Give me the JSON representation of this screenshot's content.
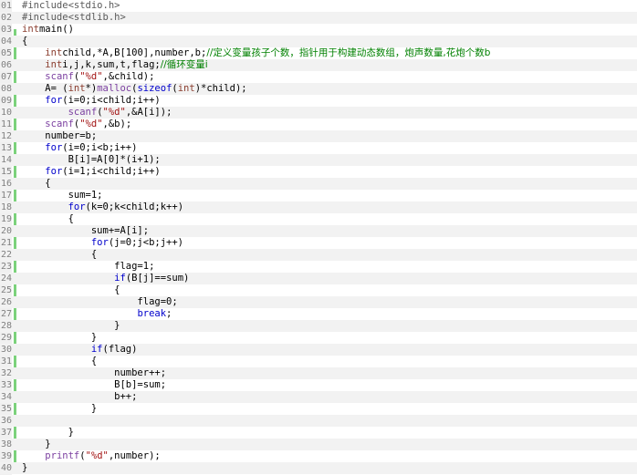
{
  "editor": {
    "lines": [
      {
        "num": "01",
        "seg": [
          [
            "pp",
            "#include<stdio.h>"
          ]
        ]
      },
      {
        "num": "02",
        "seg": [
          [
            "pp",
            "#include<stdlib.h>"
          ]
        ]
      },
      {
        "num": "03",
        "seg": [
          [
            "ty",
            "int"
          ],
          [
            "",
            "main()"
          ]
        ]
      },
      {
        "num": "04",
        "seg": [
          [
            "",
            "{"
          ]
        ]
      },
      {
        "num": "05",
        "seg": [
          [
            "",
            "    "
          ],
          [
            "ty",
            "int"
          ],
          [
            "",
            "child,*A,B[100],number,b;"
          ],
          [
            "cm",
            "//定义变量孩子个数，指针用于构建动态数组，炮声数量,花炮个数b"
          ]
        ]
      },
      {
        "num": "06",
        "seg": [
          [
            "",
            "    "
          ],
          [
            "ty",
            "int"
          ],
          [
            "",
            "i,j,k,sum,t,flag;"
          ],
          [
            "cm",
            "//循环变量i"
          ]
        ]
      },
      {
        "num": "07",
        "seg": [
          [
            "",
            "    "
          ],
          [
            "fn",
            "scanf"
          ],
          [
            "",
            "("
          ],
          [
            "str",
            "\"%d\""
          ],
          [
            "",
            ",&child);"
          ]
        ]
      },
      {
        "num": "08",
        "seg": [
          [
            "",
            "    A= ("
          ],
          [
            "ty",
            "int"
          ],
          [
            "",
            "*)"
          ],
          [
            "fn",
            "malloc"
          ],
          [
            "",
            "("
          ],
          [
            "kw",
            "sizeof"
          ],
          [
            "",
            "("
          ],
          [
            "ty",
            "int"
          ],
          [
            "",
            ")*child);"
          ]
        ]
      },
      {
        "num": "09",
        "seg": [
          [
            "",
            "    "
          ],
          [
            "kw",
            "for"
          ],
          [
            "",
            "(i=0;i<child;i++)"
          ]
        ]
      },
      {
        "num": "10",
        "seg": [
          [
            "",
            "        "
          ],
          [
            "fn",
            "scanf"
          ],
          [
            "",
            "("
          ],
          [
            "str",
            "\"%d\""
          ],
          [
            "",
            ",&A[i]);"
          ]
        ]
      },
      {
        "num": "11",
        "seg": [
          [
            "",
            "    "
          ],
          [
            "fn",
            "scanf"
          ],
          [
            "",
            "("
          ],
          [
            "str",
            "\"%d\""
          ],
          [
            "",
            ",&b);"
          ]
        ]
      },
      {
        "num": "12",
        "seg": [
          [
            "",
            "    number=b;"
          ]
        ]
      },
      {
        "num": "13",
        "seg": [
          [
            "",
            "    "
          ],
          [
            "kw",
            "for"
          ],
          [
            "",
            "(i=0;i<b;i++)"
          ]
        ]
      },
      {
        "num": "14",
        "seg": [
          [
            "",
            "        B[i]=A[0]*(i+1);"
          ]
        ]
      },
      {
        "num": "15",
        "seg": [
          [
            "",
            "    "
          ],
          [
            "kw",
            "for"
          ],
          [
            "",
            "(i=1;i<child;i++)"
          ]
        ]
      },
      {
        "num": "16",
        "seg": [
          [
            "",
            "    {"
          ]
        ]
      },
      {
        "num": "17",
        "seg": [
          [
            "",
            "        sum=1;"
          ]
        ]
      },
      {
        "num": "18",
        "seg": [
          [
            "",
            "        "
          ],
          [
            "kw",
            "for"
          ],
          [
            "",
            "(k=0;k<child;k++)"
          ]
        ]
      },
      {
        "num": "19",
        "seg": [
          [
            "",
            "        {"
          ]
        ]
      },
      {
        "num": "20",
        "seg": [
          [
            "",
            "            sum+=A[i];"
          ]
        ]
      },
      {
        "num": "21",
        "seg": [
          [
            "",
            "            "
          ],
          [
            "kw",
            "for"
          ],
          [
            "",
            "(j=0;j<b;j++)"
          ]
        ]
      },
      {
        "num": "22",
        "seg": [
          [
            "",
            "            {"
          ]
        ]
      },
      {
        "num": "23",
        "seg": [
          [
            "",
            "                flag=1;"
          ]
        ]
      },
      {
        "num": "24",
        "seg": [
          [
            "",
            "                "
          ],
          [
            "kw",
            "if"
          ],
          [
            "",
            "(B[j]==sum)"
          ]
        ]
      },
      {
        "num": "25",
        "seg": [
          [
            "",
            "                {"
          ]
        ]
      },
      {
        "num": "26",
        "seg": [
          [
            "",
            "                    flag=0;"
          ]
        ]
      },
      {
        "num": "27",
        "seg": [
          [
            "",
            "                    "
          ],
          [
            "kw",
            "break"
          ],
          [
            "",
            ";"
          ]
        ]
      },
      {
        "num": "28",
        "seg": [
          [
            "",
            "                }"
          ]
        ]
      },
      {
        "num": "29",
        "seg": [
          [
            "",
            "            }"
          ]
        ]
      },
      {
        "num": "30",
        "seg": [
          [
            "",
            "            "
          ],
          [
            "kw",
            "if"
          ],
          [
            "",
            "(flag)"
          ]
        ]
      },
      {
        "num": "31",
        "seg": [
          [
            "",
            "            {"
          ]
        ]
      },
      {
        "num": "32",
        "seg": [
          [
            "",
            "                number++;"
          ]
        ]
      },
      {
        "num": "33",
        "seg": [
          [
            "",
            "                B[b]=sum;"
          ]
        ]
      },
      {
        "num": "34",
        "seg": [
          [
            "",
            "                b++;"
          ]
        ]
      },
      {
        "num": "35",
        "seg": [
          [
            "",
            "            }"
          ]
        ]
      },
      {
        "num": "36",
        "seg": [
          [
            "",
            ""
          ]
        ]
      },
      {
        "num": "37",
        "seg": [
          [
            "",
            "        }"
          ]
        ]
      },
      {
        "num": "38",
        "seg": [
          [
            "",
            "    }"
          ]
        ]
      },
      {
        "num": "39",
        "seg": [
          [
            "",
            "    "
          ],
          [
            "fn",
            "printf"
          ],
          [
            "",
            "("
          ],
          [
            "str",
            "\"%d\""
          ],
          [
            "",
            ",number);"
          ]
        ]
      },
      {
        "num": "40",
        "seg": [
          [
            "",
            "}"
          ]
        ]
      }
    ]
  }
}
